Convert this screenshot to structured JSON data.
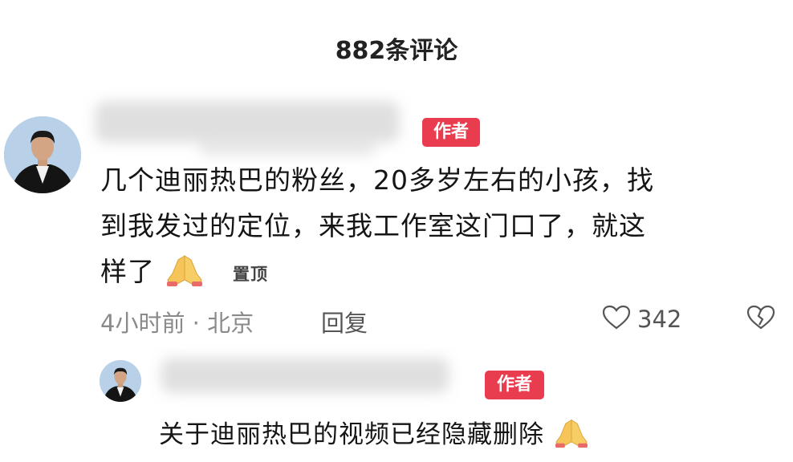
{
  "header": {
    "title": "882条评论"
  },
  "comment": {
    "author_badge": "作者",
    "lines": [
      "几个迪丽热巴的粉丝，20多岁左右的小孩，找",
      "到我发过的定位，来我工作室这门口了，就这",
      "样了"
    ],
    "pinned_label": "置顶",
    "meta": "4小时前 · 北京",
    "reply_label": "回复",
    "like_count": "342"
  },
  "reply": {
    "author_badge": "作者",
    "text": "关于迪丽热巴的视频已经隐藏删除"
  }
}
